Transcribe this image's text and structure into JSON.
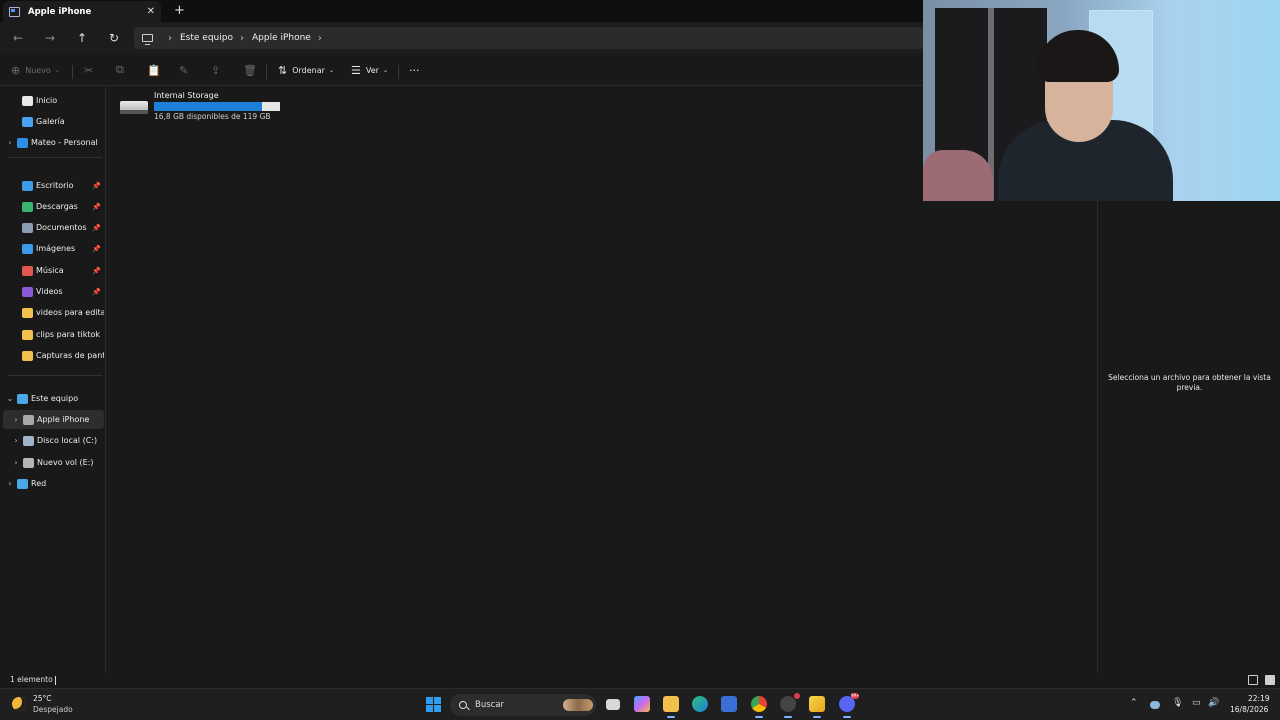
{
  "tab": {
    "title": "Apple iPhone",
    "close": "✕",
    "new": "+"
  },
  "nav": {
    "back": "←",
    "forward": "→",
    "up": "↑",
    "refresh": "↻",
    "separator": "›",
    "breadcrumbs": [
      "Este equipo",
      "Apple iPhone"
    ]
  },
  "toolbar": {
    "new_label": "Nuevo",
    "sort_label": "Ordenar",
    "view_label": "Ver",
    "more": "···",
    "cut": "✂",
    "copy": "⧉",
    "paste": "📋",
    "rename": "✎",
    "share": "⇪",
    "delete": "🗑",
    "sort_icon": "⇅",
    "view_icon": "☰",
    "new_icon": "⊕",
    "caret": "⌄"
  },
  "sidebar": {
    "items": [
      {
        "label": "Inicio",
        "icon": "home-icon",
        "color": "#e8e8e8"
      },
      {
        "label": "Galería",
        "icon": "gallery-icon",
        "color": "#4aa3f0"
      },
      {
        "label": "Mateo - Personal",
        "icon": "cloud-icon",
        "color": "#2f8fe6"
      },
      {
        "label": "Escritorio",
        "icon": "desktop-icon",
        "color": "#3f9de8"
      },
      {
        "label": "Descargas",
        "icon": "download-icon",
        "color": "#3bb56c"
      },
      {
        "label": "Documentos",
        "icon": "document-icon",
        "color": "#8a9bb4"
      },
      {
        "label": "Imágenes",
        "icon": "pictures-icon",
        "color": "#3d9ae6"
      },
      {
        "label": "Música",
        "icon": "music-icon",
        "color": "#e0574f"
      },
      {
        "label": "Videos",
        "icon": "videos-icon",
        "color": "#8c5ad9"
      },
      {
        "label": "videos para editar",
        "icon": "folder-icon",
        "color": "#f2c14d"
      },
      {
        "label": "clips para tiktok",
        "icon": "folder-icon",
        "color": "#f2c14d"
      },
      {
        "label": "Capturas de pantalla",
        "icon": "folder-icon",
        "color": "#f2c14d"
      },
      {
        "label": "Este equipo",
        "icon": "computer-icon",
        "color": "#4aa8e8"
      },
      {
        "label": "Apple iPhone",
        "icon": "phone-icon",
        "color": "#a8a8a8"
      },
      {
        "label": "Disco local (C:)",
        "icon": "drive-icon",
        "color": "#9fb4c8"
      },
      {
        "label": "Nuevo vol (E:)",
        "icon": "drive-icon",
        "color": "#b5b5b5"
      },
      {
        "label": "Red",
        "icon": "network-icon",
        "color": "#4aa8e8"
      }
    ]
  },
  "drive": {
    "name": "Internal Storage",
    "free_text": "16,8 GB disponibles de 119 GB",
    "used_fraction": 0.859
  },
  "preview": {
    "message": "Selecciona un archivo para obtener la vista previa."
  },
  "status": {
    "count": "1 elemento"
  },
  "taskbar": {
    "temp": "25°C",
    "weather": "Despejado",
    "search": "Buscar",
    "time": "22:19",
    "date": "16/8/2026",
    "badge": "99+"
  }
}
